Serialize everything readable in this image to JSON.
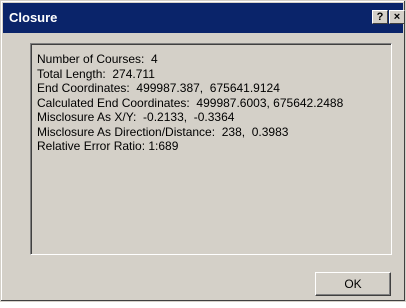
{
  "window": {
    "title": "Closure",
    "help_label": "?",
    "close_label": "×"
  },
  "report": {
    "lines": [
      "Number of Courses:  4",
      "Total Length:  274.711",
      "End Coordinates:  499987.387,  675641.9124",
      "Calculated End Coordinates:  499987.6003, 675642.2488",
      "Misclosure As X/Y:  -0.2133,  -0.3364",
      "Misclosure As Direction/Distance:  238,  0.3983",
      "Relative Error Ratio: 1:689"
    ]
  },
  "buttons": {
    "ok_label": "OK"
  }
}
